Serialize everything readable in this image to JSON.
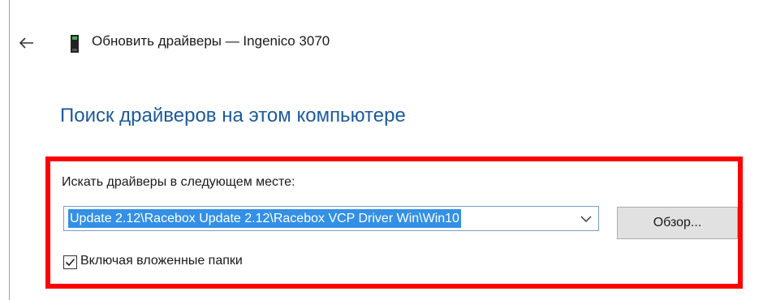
{
  "header": {
    "title": "Обновить драйверы — Ingenico 3070",
    "back_icon": "back-arrow-icon",
    "device_icon": "usb-device-icon"
  },
  "main": {
    "heading": "Поиск драйверов на этом компьютере",
    "path_label": "Искать драйверы в следующем месте:",
    "path_value": "Update 2.12\\Racebox Update 2.12\\Racebox VCP Driver Win\\Win10",
    "browse_label": "Обзор...",
    "include_subfolders_label": "Включая вложенные папки",
    "include_subfolders_checked": true
  },
  "colors": {
    "heading": "#1c5a9c",
    "selection": "#3390e6",
    "highlight_frame": "#ff0000"
  }
}
